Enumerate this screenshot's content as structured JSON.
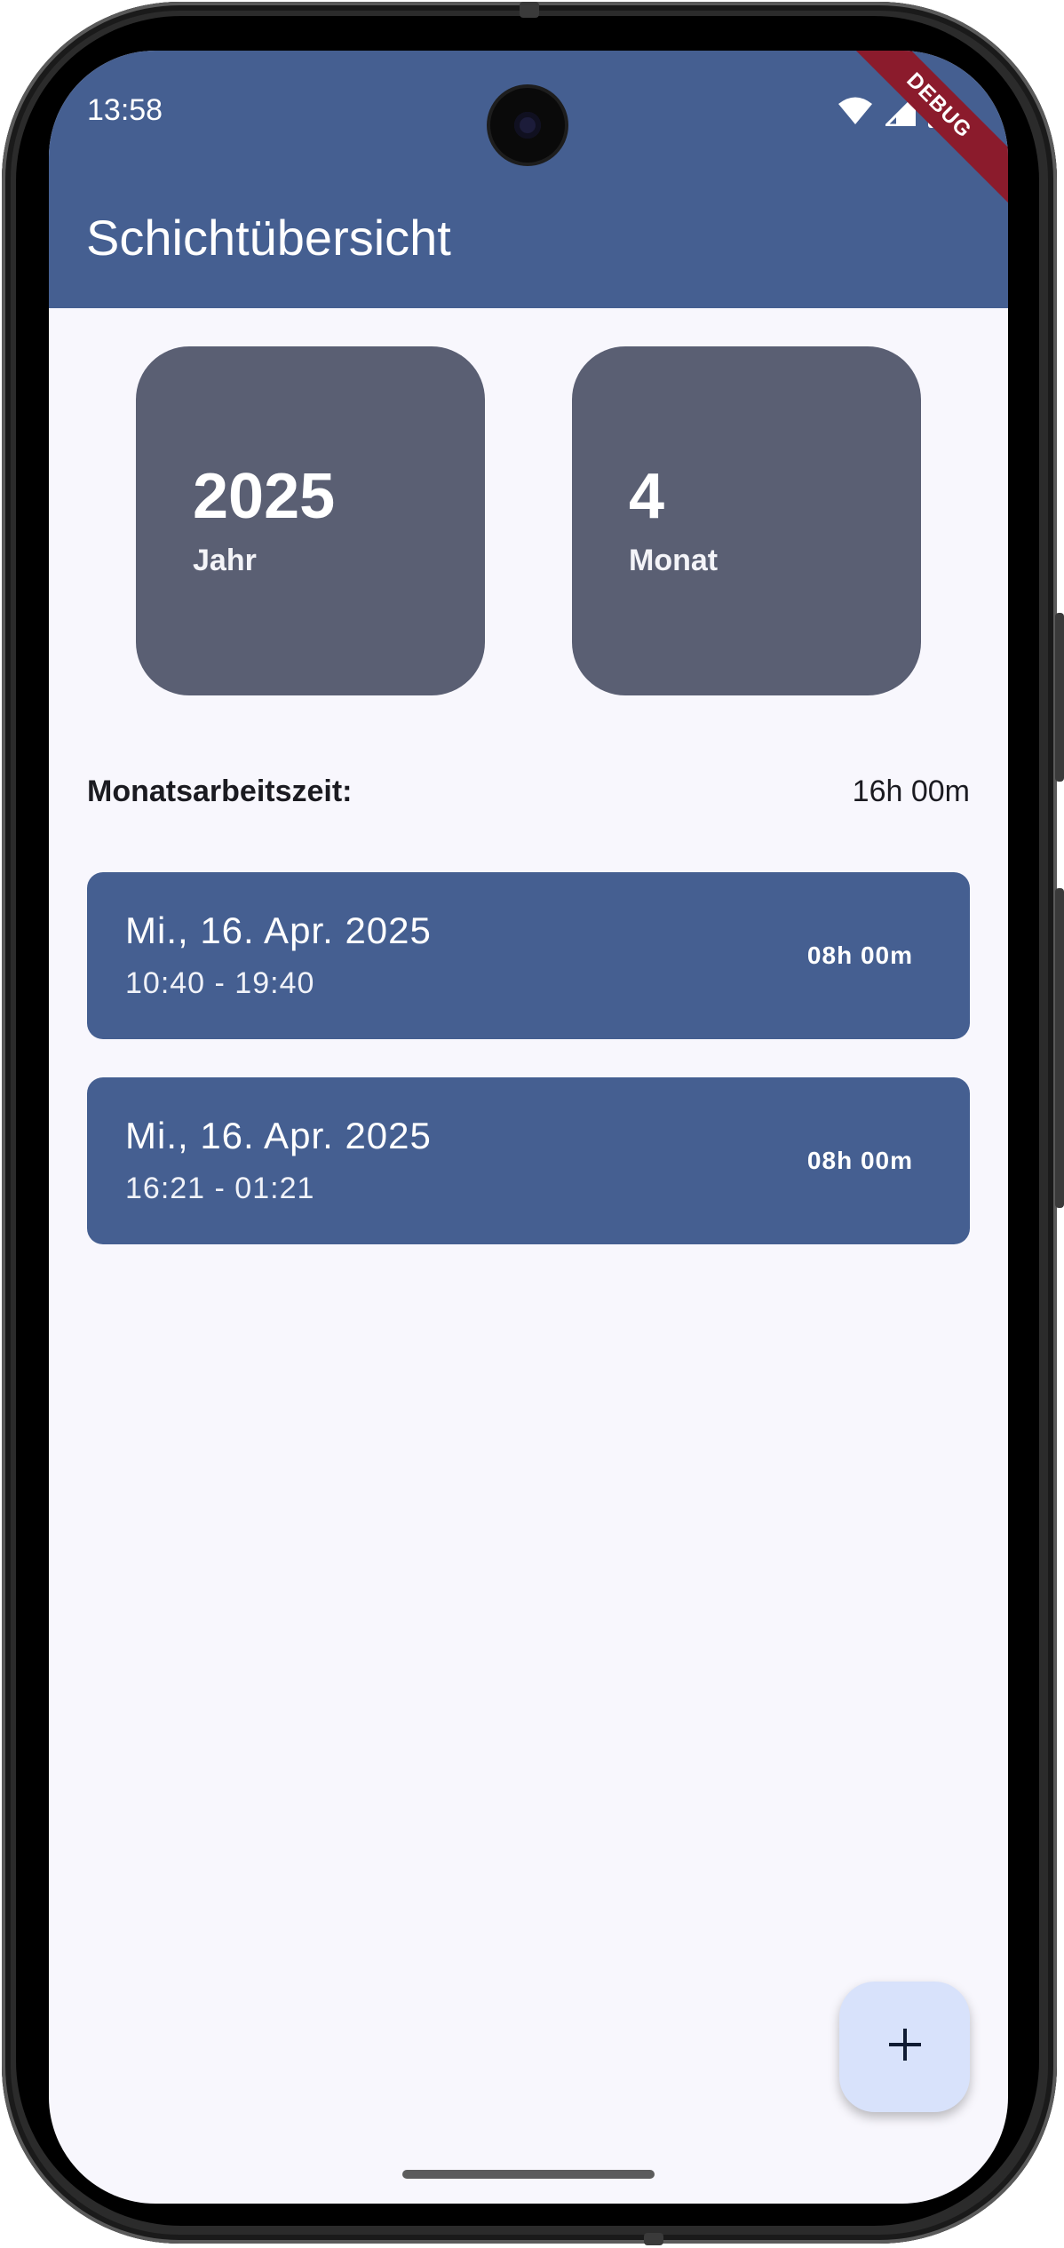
{
  "status_bar": {
    "time": "13:58",
    "icons": [
      "wifi-icon",
      "cellular-signal-icon",
      "battery-icon"
    ]
  },
  "debug_banner": "DEBUG",
  "app_bar": {
    "title": "Schichtübersicht"
  },
  "stats": {
    "year": {
      "value": "2025",
      "label": "Jahr"
    },
    "month": {
      "value": "4",
      "label": "Monat"
    }
  },
  "summary": {
    "label": "Monatsarbeitszeit:",
    "value": "16h 00m"
  },
  "shifts": [
    {
      "date": "Mi., 16. Apr. 2025",
      "time": "10:40 - 19:40",
      "duration": "08h 00m"
    },
    {
      "date": "Mi., 16. Apr. 2025",
      "time": "16:21 - 01:21",
      "duration": "08h 00m"
    }
  ],
  "fab": {
    "icon": "plus-icon"
  },
  "colors": {
    "primary": "#455f91",
    "card": "#5a5f73",
    "background": "#f8f7fd",
    "fab": "#d8e2fb",
    "debug": "#8b1b2c"
  }
}
